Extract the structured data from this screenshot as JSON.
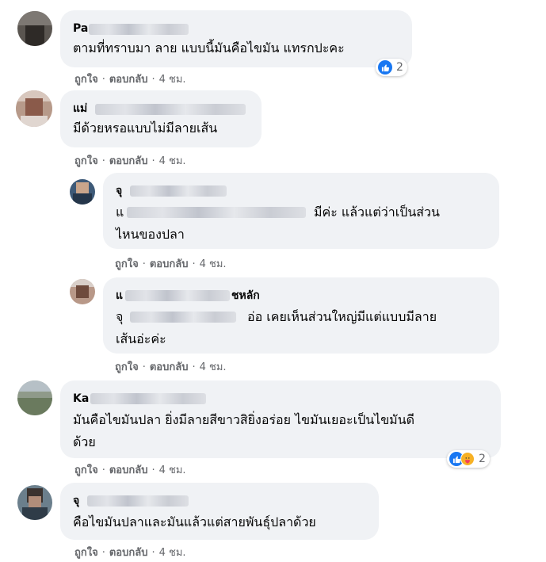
{
  "actions": {
    "like": "ถูกใจ",
    "reply": "ตอบกลับ",
    "sep": "·"
  },
  "comments": [
    {
      "name_prefix": "Pa",
      "line1": "ตามที่ทราบมา ลาย แบบนี้มันคือไขมัน แทรกปะคะ",
      "time": "4 ชม.",
      "reaction_count": "2",
      "reaction_icons": [
        "like-icon"
      ]
    },
    {
      "name_prefix": "แม่",
      "line1": "มีด้วยหรอแบบไม่มีลายเส้น",
      "time": "4 ชม."
    },
    {
      "name_prefix": "จุ",
      "line1_prefix": "แ",
      "line1": "มีค่ะ แล้วแต่ว่าเป็นส่วน",
      "line2": "ไหนของปลา",
      "time": "4 ชม."
    },
    {
      "name_prefix": "แ",
      "name_suffix": "ชหลัก",
      "line1_prefix": "จุ",
      "line1": "อ่อ เคยเห็นส่วนใหญ่มีแต่แบบมีลาย",
      "line2": "เส้นอ่ะค่ะ",
      "time": "4 ชม."
    },
    {
      "name_prefix": "Ka",
      "line1": "มันคือไขมันปลา ยิ่งมีลายสีขาวสิยิ่งอร่อย ไขมันเยอะเป็นไขมันดี",
      "line2": "ด้วย",
      "time": "4 ชม.",
      "reaction_count": "2",
      "reaction_icons": [
        "like-icon",
        "care-icon"
      ]
    },
    {
      "name_prefix": "จุ",
      "line1": "คือไขมันปลาและมันแล้วแต่สายพันธุ์ปลาด้วย",
      "time": "4 ชม."
    }
  ],
  "colors": {
    "bubble": "#f0f2f5",
    "meta": "#65676b",
    "like": "#1877f2",
    "care": "#f7b125"
  }
}
